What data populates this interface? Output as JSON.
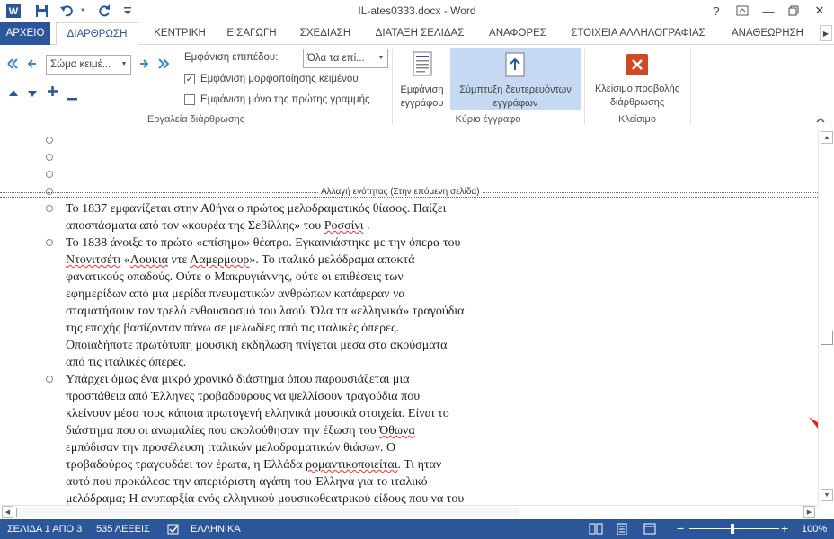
{
  "window": {
    "title": "IL-ates0333.docx - Word",
    "help": "?",
    "minimize": "—",
    "close": "✕"
  },
  "tabs": [
    {
      "label": "ΑΡΧΕΙΟ"
    },
    {
      "label": "ΔΙΑΡΘΡΩΣΗ"
    },
    {
      "label": "ΚΕΝΤΡΙΚΗ"
    },
    {
      "label": "ΕΙΣΑΓΩΓΗ"
    },
    {
      "label": "ΣΧΕΔΙΑΣΗ"
    },
    {
      "label": "ΔΙΑΤΑΞΗ ΣΕΛΙΔΑΣ"
    },
    {
      "label": "ΑΝΑΦΟΡΕΣ"
    },
    {
      "label": "ΣΤΟΙΧΕΙΑ ΑΛΛΗΛΟΓΡΑΦΙΑΣ"
    },
    {
      "label": "ΑΝΑΘΕΩΡΗΣΗ"
    }
  ],
  "ribbon": {
    "outline_tools": {
      "level_value": "Σώμα κειμέ...",
      "show_level_label": "Εμφάνιση επιπέδου:",
      "show_level_value": "Όλα τα επί...",
      "show_formatting": "Εμφάνιση μορφοποίησης κειμένου",
      "show_first_line": "Εμφάνιση μόνο της πρώτης γραμμής",
      "group_label": "Εργαλεία διάρθρωσης"
    },
    "master_document": {
      "show_document_l1": "Εμφάνιση",
      "show_document_l2": "εγγράφου",
      "collapse_l1": "Σύμπτυξη δευτερευόντων",
      "collapse_l2": "εγγράφων",
      "group_label": "Κύριο έγγραφο"
    },
    "close": {
      "close_view_l1": "Κλείσιμο προβολής",
      "close_view_l2": "διάρθρωσης",
      "group_label": "Κλείσιμο"
    }
  },
  "document": {
    "section_break": "Αλλαγή ενότητας (Στην επόμενη σελίδα)",
    "p1": [
      "Το 1837 εμφανίζεται στην Αθήνα ο πρώτος μελοδραματικός θίασος. Παίζει",
      "αποσπάσματα από τον  «κουρέα της Σεβίλλης» του ",
      "Ροσσίνι",
      " ."
    ],
    "p2": {
      "l1": "Το 1838 άνοιξε το πρώτο «επίσημο» θέατρο. Εγκαινιάστηκε με την όπερα του",
      "l2a": "Ντονιτσέτι",
      "l2b": " «",
      "l2c": "Λουκια",
      "l2d": " ντε ",
      "l2e": "Λαμερμουρ",
      "l2f": "». Το ιταλικό μελόδραμα αποκτά",
      "l3": "φανατικούς οπαδούς. Ούτε ο Μακρυγιάννης, ούτε οι επιθέσεις των",
      "l4": "εφημερίδων από μια μερίδα πνευματικών ανθρώπων κατάφεραν να",
      "l5": "σταματήσουν τον τρελό ενθουσιασμό του λαού. Όλα τα «ελληνικά» τραγούδια",
      "l6": "της εποχής βασίζονταν πάνω σε μελωδίες από τις ιταλικές όπερες.",
      "l7": "Οποιαδήποτε πρωτότυπη μουσική εκδήλωση πνίγεται μέσα στα ακούσματα",
      "l8": "από τις ιταλικές όπερες."
    },
    "p3": {
      "l1": "Υπάρχει όμως ένα μικρό χρονικό διάστημα όπου παρουσιάζεται μια",
      "l2": "προσπάθεια από  Έλληνες τροβαδούρους να ψελλίσουν τραγούδια που",
      "l3": "κλείνουν μέσα τους κάποια πρωτογενή ελληνικά μουσικά στοιχεία. Είναι το",
      "l4a": "διάστημα που οι ανωμαλίες που ακολούθησαν την έξωση του ",
      "l4b": "Όθωνα",
      "l5": "εμπόδισαν την προσέλευση ιταλικών μελοδραματικών θιάσων. Ο",
      "l6a": "τροβαδούρος τραγουδάει τον έρωτα, η Ελλάδα ",
      "l6b": "ρομαντικοποιείται",
      "l6c": ".  Τι ήταν",
      "l7": "αυτό που προκάλεσε την απεριόριστη αγάπη του Έλληνα για το ιταλικό",
      "l8": "μελόδραμα; Η ανυπαρξία ενός ελληνικού μουσικοθεατρικού είδους που να του"
    }
  },
  "status": {
    "page": "ΣΕΛΙΔΑ 1 ΑΠΟ 3",
    "words": "535 ΛΕΞΕΙΣ",
    "language": "ΕΛΛΗΝΙΚΑ",
    "zoom": "100%",
    "zoom_minus": "−",
    "zoom_plus": "+"
  },
  "colors": {
    "accent": "#2b579a",
    "close_red": "#d24726",
    "collapse_active_bg": "#c5daf2"
  },
  "icons": [
    "word-app-icon",
    "save-icon",
    "undo-icon",
    "redo-icon",
    "customize-qa-icon",
    "restore-icon",
    "maximize-icon",
    "close-icon"
  ]
}
